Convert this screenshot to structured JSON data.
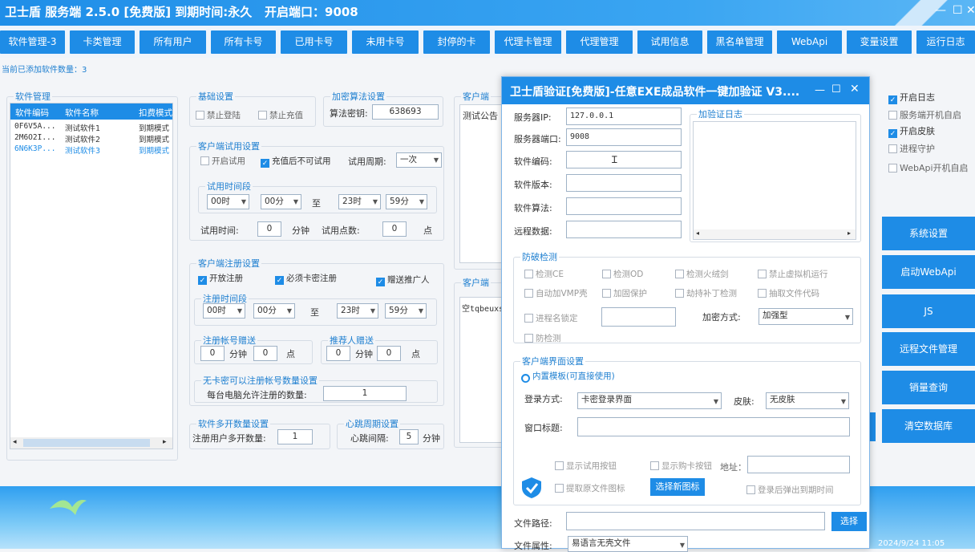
{
  "window": {
    "title": "卫士盾 服务端 2.5.0  [免费版] 到期时间:永久",
    "port": "开启端口：9008",
    "min": "—",
    "max": "☐",
    "close": "✕"
  },
  "nav": [
    "软件管理-3",
    "卡类管理",
    "所有用户",
    "所有卡号",
    "已用卡号",
    "未用卡号",
    "封停的卡",
    "代理卡管理",
    "代理管理",
    "试用信息",
    "黑名单管理",
    "WebApi",
    "变量设置",
    "运行日志"
  ],
  "count_label": "当前已添加软件数量：3",
  "software": {
    "legend": "软件管理",
    "headers": [
      "软件编码",
      "软件名称",
      "扣费模式"
    ],
    "rows": [
      [
        "0F6V5A...",
        "测试软件1",
        "到期模式"
      ],
      [
        "2M6O2I...",
        "测试软件2",
        "到期模式"
      ],
      [
        "6N6K3P...",
        "测试软件3",
        "到期模式"
      ]
    ],
    "scroll_left": "◂",
    "scroll_right": "▸"
  },
  "basic": {
    "legend": "基础设置",
    "disable_login": "禁止登陆",
    "disable_recharge": "禁止充值"
  },
  "encrypt": {
    "legend": "加密算法设置",
    "key_label": "算法密钥:",
    "key_value": "638693"
  },
  "trial": {
    "legend": "客户端试用设置",
    "enable": "开启试用",
    "no_trial_after_recharge": "充值后不可试用",
    "period_label": "试用周期:",
    "period_value": "一次",
    "time_legend": "试用时间段",
    "start_hour": "00时",
    "start_min": "00分",
    "to": "至",
    "end_hour": "23时",
    "end_min": "59分",
    "time_label": "试用时间:",
    "time_value": "0",
    "minutes": "分钟",
    "points_label": "试用点数:",
    "points_value": "0",
    "points_unit": "点"
  },
  "register": {
    "legend": "客户端注册设置",
    "enable": "开放注册",
    "require_card": "必须卡密注册",
    "gift_referrer": "赠送推广人",
    "time_legend": "注册时间段",
    "start_hour": "00时",
    "start_min": "00分",
    "to": "至",
    "end_hour": "23时",
    "end_min": "59分",
    "gift_legend": "注册帐号赠送",
    "gift_min": "0",
    "gift_min_unit": "分钟",
    "gift_pts": "0",
    "gift_pts_unit": "点",
    "ref_legend": "推荐人赠送",
    "ref_min": "0",
    "ref_min_unit": "分钟",
    "ref_pts": "0",
    "ref_pts_unit": "点",
    "nocard_legend": "无卡密可以注册帐号数量设置",
    "nocard_label": "每台电脑允许注册的数量:",
    "nocard_value": "1"
  },
  "multi": {
    "legend": "软件多开数量设置",
    "label": "注册用户多开数量:",
    "value": "1"
  },
  "heartbeat": {
    "legend": "心跳周期设置",
    "label": "心跳间隔:",
    "value": "5",
    "unit": "分钟"
  },
  "notice": {
    "legend": "客户端",
    "text": "测试公告"
  },
  "notice2": {
    "legend": "客户端",
    "text": "空tqbeuxs"
  },
  "right_checks": [
    {
      "label": "开启日志",
      "on": true
    },
    {
      "label": "服务端开机自启",
      "on": false
    },
    {
      "label": "开启皮肤",
      "on": true
    },
    {
      "label": "进程守护",
      "on": false
    },
    {
      "label": "WebApi开机自启",
      "on": false
    }
  ],
  "right_buttons": [
    "系统设置",
    "启动WebApi",
    "JS",
    "远程文件管理",
    "销量查询",
    "清空数据库"
  ],
  "dialog": {
    "title": "卫士盾验证[免费版]-任意EXE成品软件一键加验证 V3....",
    "min": "—",
    "max": "☐",
    "close": "✕",
    "server_ip_label": "服务器IP:",
    "server_ip": "127.0.0.1",
    "server_port_label": "服务器端口:",
    "server_port": "9008",
    "sw_code_label": "软件编码:",
    "sw_version_label": "软件版本:",
    "sw_algo_label": "软件算法:",
    "remote_label": "远程数据:",
    "log_legend": "加验证日志",
    "anti_legend": "防破检测",
    "anti": [
      "检测CE",
      "检测OD",
      "检测火绒剑",
      "禁止虚拟机运行",
      "自动加VMP壳",
      "加固保护",
      "劫持补丁检测",
      "抽取文件代码",
      "进程名锁定",
      "防检测"
    ],
    "enc_label": "加密方式:",
    "enc_value": "加强型",
    "ui_legend": "客户端界面设置",
    "builtin": "内置模板(可直接使用)",
    "login_label": "登录方式:",
    "login_value": "卡密登录界面",
    "skin_label": "皮肤:",
    "skin_value": "无皮肤",
    "win_title_label": "窗口标题:",
    "show_trial": "显示试用按钮",
    "show_buy": "显示购卡按钮",
    "addr_label": "地址：",
    "extract_icon": "提取原文件图标",
    "choose_icon": "选择新图标",
    "popup_expiry": "登录后弹出到期时间",
    "path_label": "文件路径:",
    "choose": "选择",
    "attr_label": "文件属性:",
    "attr_value": "易语言无壳文件"
  },
  "clock": "2024/9/24 11:05"
}
